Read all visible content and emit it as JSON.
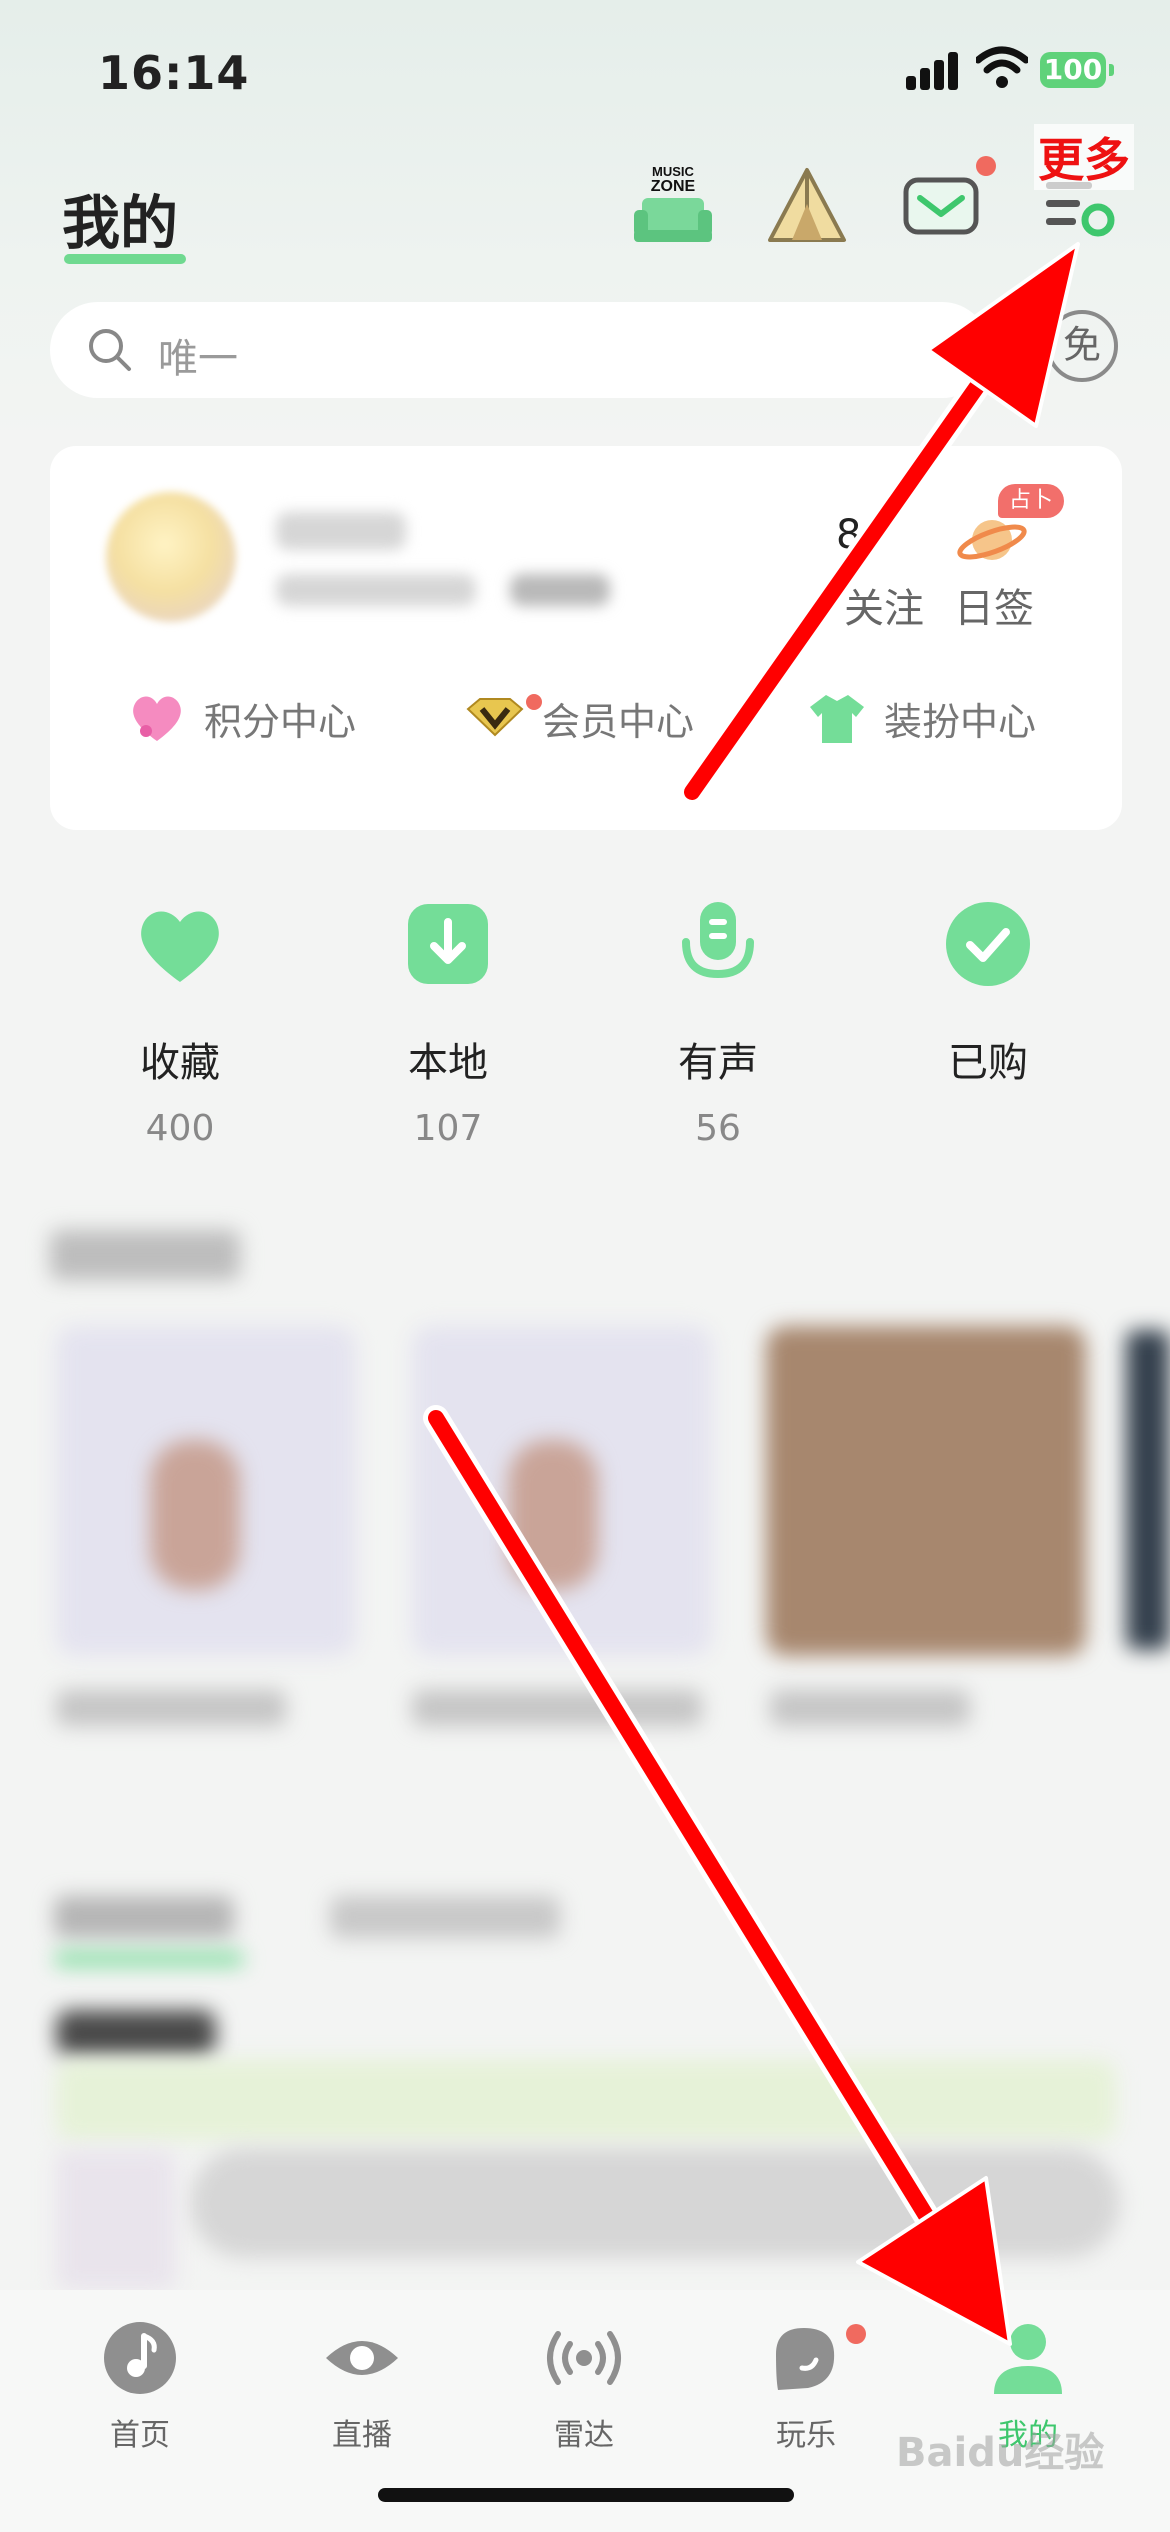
{
  "status_bar": {
    "time": "16:14",
    "battery": "100"
  },
  "header": {
    "title": "我的",
    "music_zone_icon_text": "MUSIC ZONE",
    "more_label": "更多"
  },
  "search": {
    "placeholder": "唯一",
    "free_badge": "免"
  },
  "profile": {
    "stat_number": "8",
    "follow_label": "关注",
    "sign_in_label": "日签",
    "divination_badge": "占卜",
    "links": [
      {
        "label": "积分中心"
      },
      {
        "label": "会员中心"
      },
      {
        "label": "装扮中心"
      }
    ]
  },
  "quick_stats": [
    {
      "label": "收藏",
      "count": "400"
    },
    {
      "label": "本地",
      "count": "107"
    },
    {
      "label": "有声",
      "count": "56"
    },
    {
      "label": "已购",
      "count": ""
    }
  ],
  "tab_bar": {
    "items": [
      {
        "label": "首页"
      },
      {
        "label": "直播"
      },
      {
        "label": "雷达"
      },
      {
        "label": "玩乐"
      },
      {
        "label": "我的"
      }
    ],
    "active": "我的"
  },
  "watermark": "Baidu经验",
  "colors": {
    "accent": "#3ec76d",
    "icon_green": "#74dd98",
    "annotation_red": "#ff0000"
  }
}
